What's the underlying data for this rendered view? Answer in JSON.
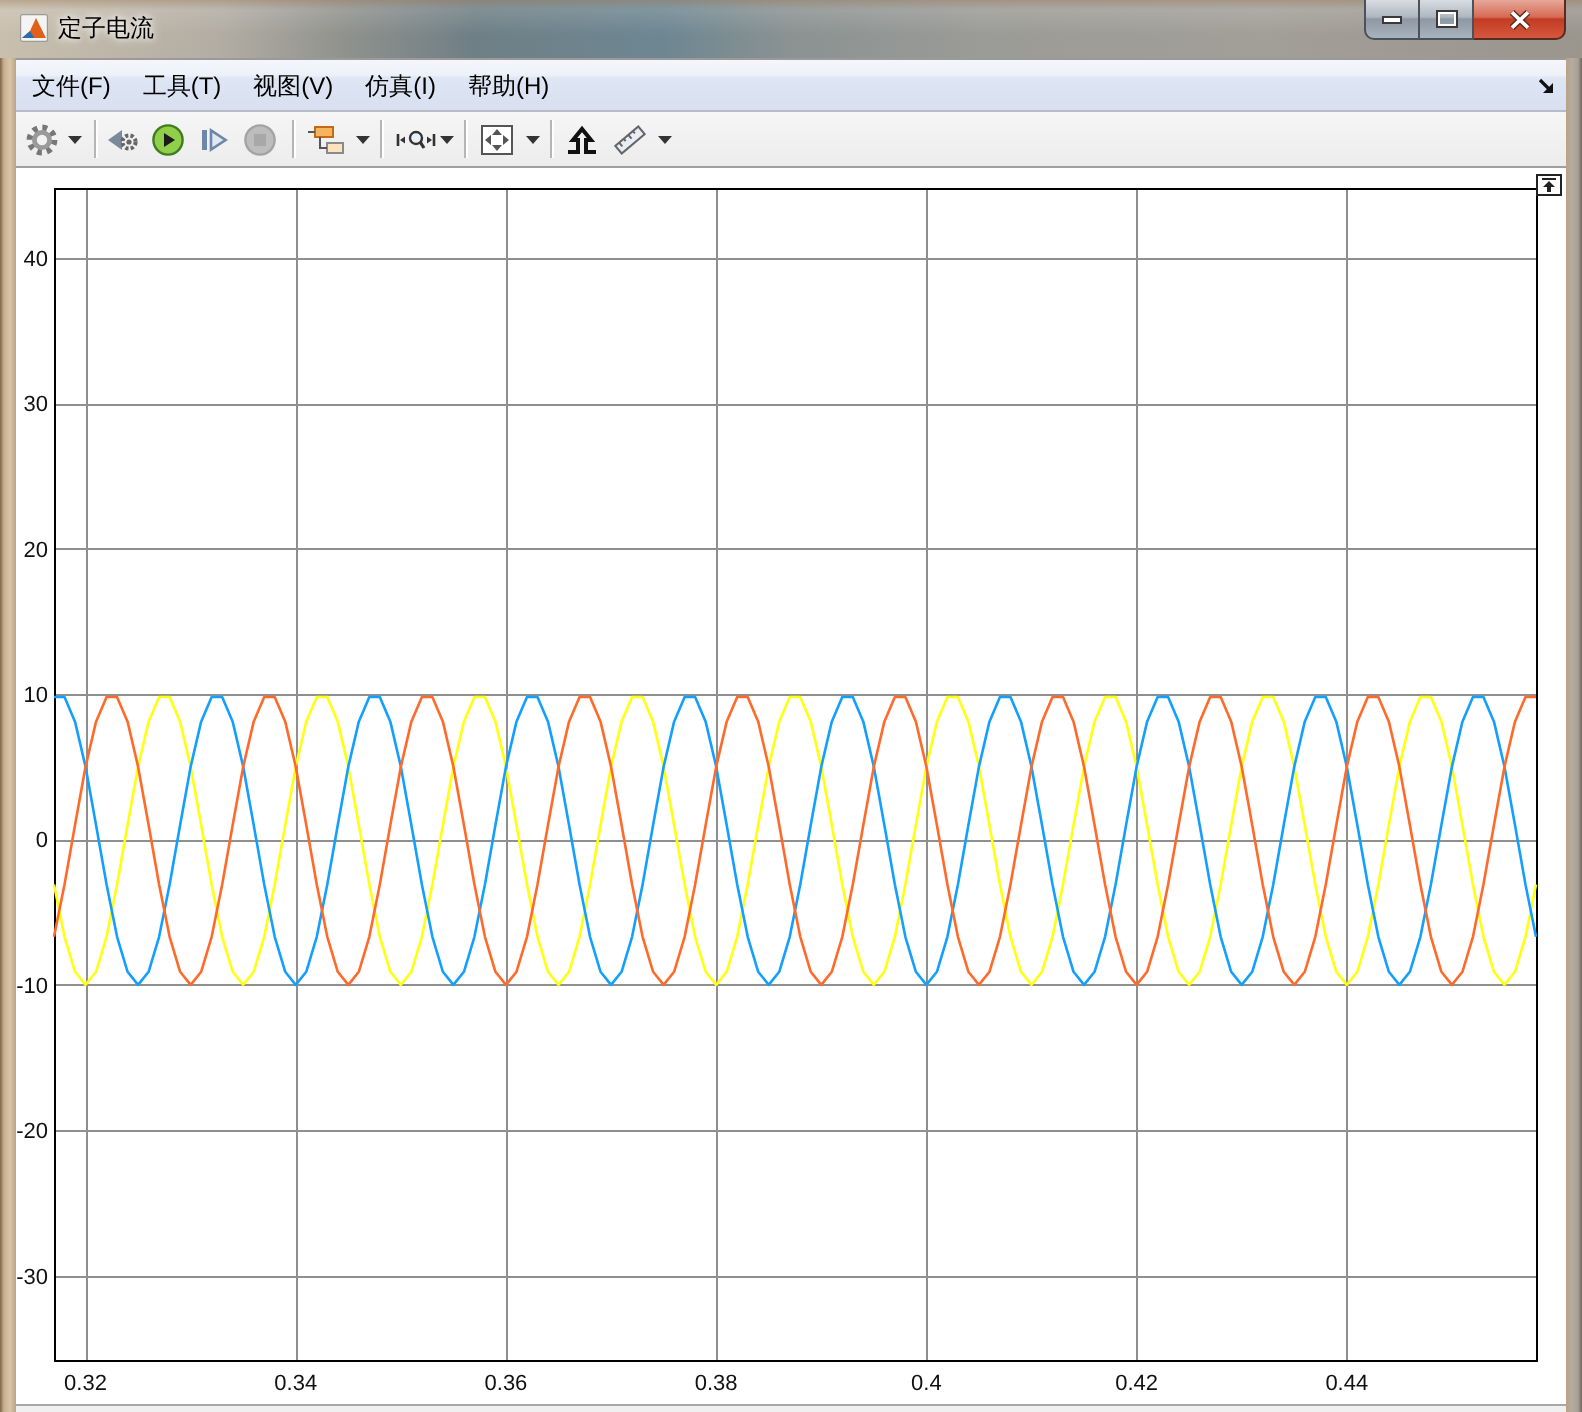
{
  "window": {
    "title": "定子电流"
  },
  "menu": [
    "文件(F)",
    "工具(T)",
    "视图(V)",
    "仿真(I)",
    "帮助(H)"
  ],
  "toolbar": {
    "stop_button": {
      "disabled": true
    }
  },
  "scope": {
    "chart_data": {
      "type": "line",
      "x": [
        0.317,
        0.318,
        0.319,
        0.32,
        0.321,
        0.322,
        0.323,
        0.324,
        0.325,
        0.326,
        0.327,
        0.328,
        0.329,
        0.33,
        0.331,
        0.332,
        0.333,
        0.334,
        0.335,
        0.336,
        0.337,
        0.338,
        0.339,
        0.34,
        0.341,
        0.342,
        0.343,
        0.344,
        0.345,
        0.346,
        0.347,
        0.348,
        0.349,
        0.35,
        0.351,
        0.352,
        0.353,
        0.354,
        0.355,
        0.356,
        0.357,
        0.358,
        0.359,
        0.36,
        0.361,
        0.362,
        0.363,
        0.364,
        0.365,
        0.366,
        0.367,
        0.368,
        0.369,
        0.37,
        0.371,
        0.372,
        0.373,
        0.374,
        0.375,
        0.376,
        0.377,
        0.378,
        0.379,
        0.38,
        0.381,
        0.382,
        0.383,
        0.384,
        0.385,
        0.386,
        0.387,
        0.388,
        0.389,
        0.39,
        0.391,
        0.392,
        0.393,
        0.394,
        0.395,
        0.396,
        0.397,
        0.398,
        0.399,
        0.4,
        0.401,
        0.402,
        0.403,
        0.404,
        0.405,
        0.406,
        0.407,
        0.408,
        0.409,
        0.41,
        0.411,
        0.412,
        0.413,
        0.414,
        0.415,
        0.416,
        0.417,
        0.418,
        0.419,
        0.42,
        0.421,
        0.422,
        0.423,
        0.424,
        0.425,
        0.426,
        0.427,
        0.428,
        0.429,
        0.43,
        0.431,
        0.432,
        0.433,
        0.434,
        0.435,
        0.436,
        0.437,
        0.438,
        0.439,
        0.44,
        0.441,
        0.442,
        0.443,
        0.444,
        0.445,
        0.446,
        0.447,
        0.448,
        0.449,
        0.45,
        0.451,
        0.452,
        0.453,
        0.454,
        0.455,
        0.456,
        0.457,
        0.458
      ],
      "series": [
        {
          "color": "#ffff11",
          "values": [
            -3.1,
            -6.7,
            -9.1,
            -10,
            -9.1,
            -6.7,
            -3.1,
            1,
            5,
            8.1,
            9.8,
            9.8,
            8.1,
            5,
            1,
            -3.1,
            -6.7,
            -9.1,
            -10,
            -9.1,
            -6.7,
            -3.1,
            1,
            5,
            8.1,
            9.8,
            9.8,
            8.1,
            5,
            1,
            -3.1,
            -6.7,
            -9.1,
            -10,
            -9.1,
            -6.7,
            -3.1,
            1,
            5,
            8.1,
            9.8,
            9.8,
            8.1,
            5,
            1,
            -3.1,
            -6.7,
            -9.1,
            -10,
            -9.1,
            -6.7,
            -3.1,
            1,
            5,
            8.1,
            9.8,
            9.8,
            8.1,
            5,
            1,
            -3.1,
            -6.7,
            -9.1,
            -10,
            -9.1,
            -6.7,
            -3.1,
            1,
            5,
            8.1,
            9.8,
            9.8,
            8.1,
            5,
            1,
            -3.1,
            -6.7,
            -9.1,
            -10,
            -9.1,
            -6.7,
            -3.1,
            1,
            5,
            8.1,
            9.8,
            9.8,
            8.1,
            5,
            1,
            -3.1,
            -6.7,
            -9.1,
            -10,
            -9.1,
            -6.7,
            -3.1,
            1,
            5,
            8.1,
            9.8,
            9.8,
            8.1,
            5,
            1,
            -3.1,
            -6.7,
            -9.1,
            -10,
            -9.1,
            -6.7,
            -3.1,
            1,
            5,
            8.1,
            9.8,
            9.8,
            8.1,
            5,
            1,
            -3.1,
            -6.7,
            -9.1,
            -10,
            -9.1,
            -6.7,
            -3.1,
            1,
            5,
            8.1,
            9.8,
            9.8,
            8.1,
            5,
            1,
            -3.1,
            -6.7,
            -9.1,
            -10,
            -9.1,
            -6.7,
            -3.1
          ]
        },
        {
          "color": "#139fff",
          "values": [
            9.8,
            9.8,
            8.1,
            5,
            1,
            -3.1,
            -6.7,
            -9.1,
            -10,
            -9.1,
            -6.7,
            -3.1,
            1,
            5,
            8.1,
            9.8,
            9.8,
            8.1,
            5,
            1,
            -3.1,
            -6.7,
            -9.1,
            -10,
            -9.1,
            -6.7,
            -3.1,
            1,
            5,
            8.1,
            9.8,
            9.8,
            8.1,
            5,
            1,
            -3.1,
            -6.7,
            -9.1,
            -10,
            -9.1,
            -6.7,
            -3.1,
            1,
            5,
            8.1,
            9.8,
            9.8,
            8.1,
            5,
            1,
            -3.1,
            -6.7,
            -9.1,
            -10,
            -9.1,
            -6.7,
            -3.1,
            1,
            5,
            8.1,
            9.8,
            9.8,
            8.1,
            5,
            1,
            -3.1,
            -6.7,
            -9.1,
            -10,
            -9.1,
            -6.7,
            -3.1,
            1,
            5,
            8.1,
            9.8,
            9.8,
            8.1,
            5,
            1,
            -3.1,
            -6.7,
            -9.1,
            -10,
            -9.1,
            -6.7,
            -3.1,
            1,
            5,
            8.1,
            9.8,
            9.8,
            8.1,
            5,
            1,
            -3.1,
            -6.7,
            -9.1,
            -10,
            -9.1,
            -6.7,
            -3.1,
            1,
            5,
            8.1,
            9.8,
            9.8,
            8.1,
            5,
            1,
            -3.1,
            -6.7,
            -9.1,
            -10,
            -9.1,
            -6.7,
            -3.1,
            1,
            5,
            8.1,
            9.8,
            9.8,
            8.1,
            5,
            1,
            -3.1,
            -6.7,
            -9.1,
            -10,
            -9.1,
            -6.7,
            -3.1,
            1,
            5,
            8.1,
            9.8,
            9.8,
            8.1,
            5,
            1,
            -3.1,
            -6.7
          ]
        },
        {
          "color": "#ff6929",
          "values": [
            -6.7,
            -3.1,
            1,
            5,
            8.1,
            9.8,
            9.8,
            8.1,
            5,
            1,
            -3.1,
            -6.7,
            -9.1,
            -10,
            -9.1,
            -6.7,
            -3.1,
            1,
            5,
            8.1,
            9.8,
            9.8,
            8.1,
            5,
            1,
            -3.1,
            -6.7,
            -9.1,
            -10,
            -9.1,
            -6.7,
            -3.1,
            1,
            5,
            8.1,
            9.8,
            9.8,
            8.1,
            5,
            1,
            -3.1,
            -6.7,
            -9.1,
            -10,
            -9.1,
            -6.7,
            -3.1,
            1,
            5,
            8.1,
            9.8,
            9.8,
            8.1,
            5,
            1,
            -3.1,
            -6.7,
            -9.1,
            -10,
            -9.1,
            -6.7,
            -3.1,
            1,
            5,
            8.1,
            9.8,
            9.8,
            8.1,
            5,
            1,
            -3.1,
            -6.7,
            -9.1,
            -10,
            -9.1,
            -6.7,
            -3.1,
            1,
            5,
            8.1,
            9.8,
            9.8,
            8.1,
            5,
            1,
            -3.1,
            -6.7,
            -9.1,
            -10,
            -9.1,
            -6.7,
            -3.1,
            1,
            5,
            8.1,
            9.8,
            9.8,
            8.1,
            5,
            1,
            -3.1,
            -6.7,
            -9.1,
            -10,
            -9.1,
            -6.7,
            -3.1,
            1,
            5,
            8.1,
            9.8,
            9.8,
            8.1,
            5,
            1,
            -3.1,
            -6.7,
            -9.1,
            -10,
            -9.1,
            -6.7,
            -3.1,
            1,
            5,
            8.1,
            9.8,
            9.8,
            8.1,
            5,
            1,
            -3.1,
            -6.7,
            -9.1,
            -10,
            -9.1,
            -6.7,
            -3.1,
            1,
            5,
            8.1,
            9.8,
            9.8
          ]
        }
      ],
      "xlim": [
        0.317,
        0.458
      ],
      "ylim": [
        -35.8,
        44.8
      ],
      "xticks": [
        0.32,
        0.34,
        0.36,
        0.38,
        0.4,
        0.42,
        0.44
      ],
      "yticks": [
        -30,
        -20,
        -10,
        0,
        10,
        20,
        30,
        40
      ],
      "grid": true
    }
  }
}
